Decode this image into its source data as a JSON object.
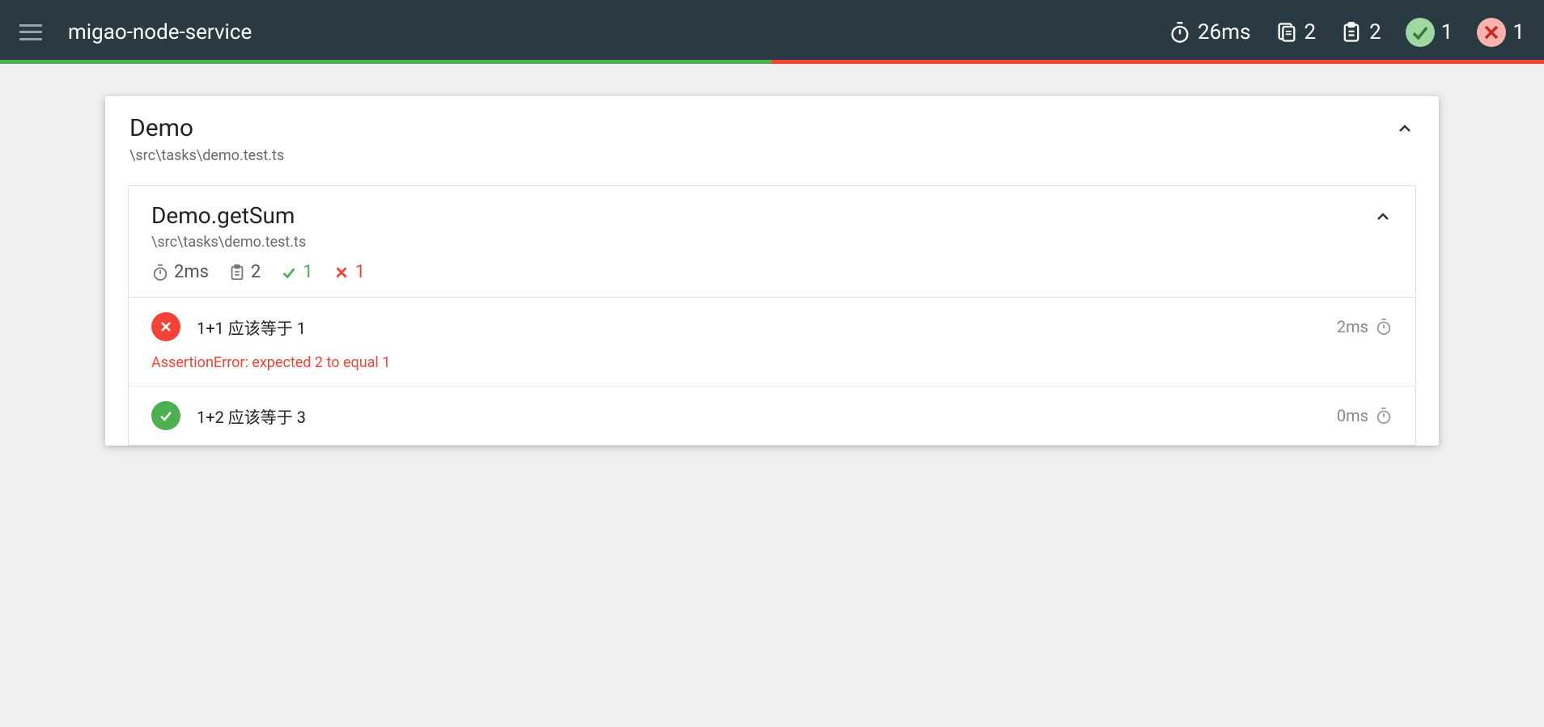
{
  "header": {
    "title": "migao-node-service",
    "duration": "26ms",
    "suites": "2",
    "tests": "2",
    "passed": "1",
    "failed": "1",
    "progress_pass_pct": 50,
    "progress_fail_pct": 50
  },
  "suite": {
    "title": "Demo",
    "path": "\\src\\tasks\\demo.test.ts",
    "groups": [
      {
        "title": "Demo.getSum",
        "path": "\\src\\tasks\\demo.test.ts",
        "duration": "2ms",
        "tests": "2",
        "passed": "1",
        "failed": "1",
        "items": [
          {
            "status": "fail",
            "name": "1+1 应该等于 1",
            "duration": "2ms",
            "error": "AssertionError: expected 2 to equal 1"
          },
          {
            "status": "pass",
            "name": "1+2 应该等于 3",
            "duration": "0ms"
          }
        ]
      }
    ]
  }
}
